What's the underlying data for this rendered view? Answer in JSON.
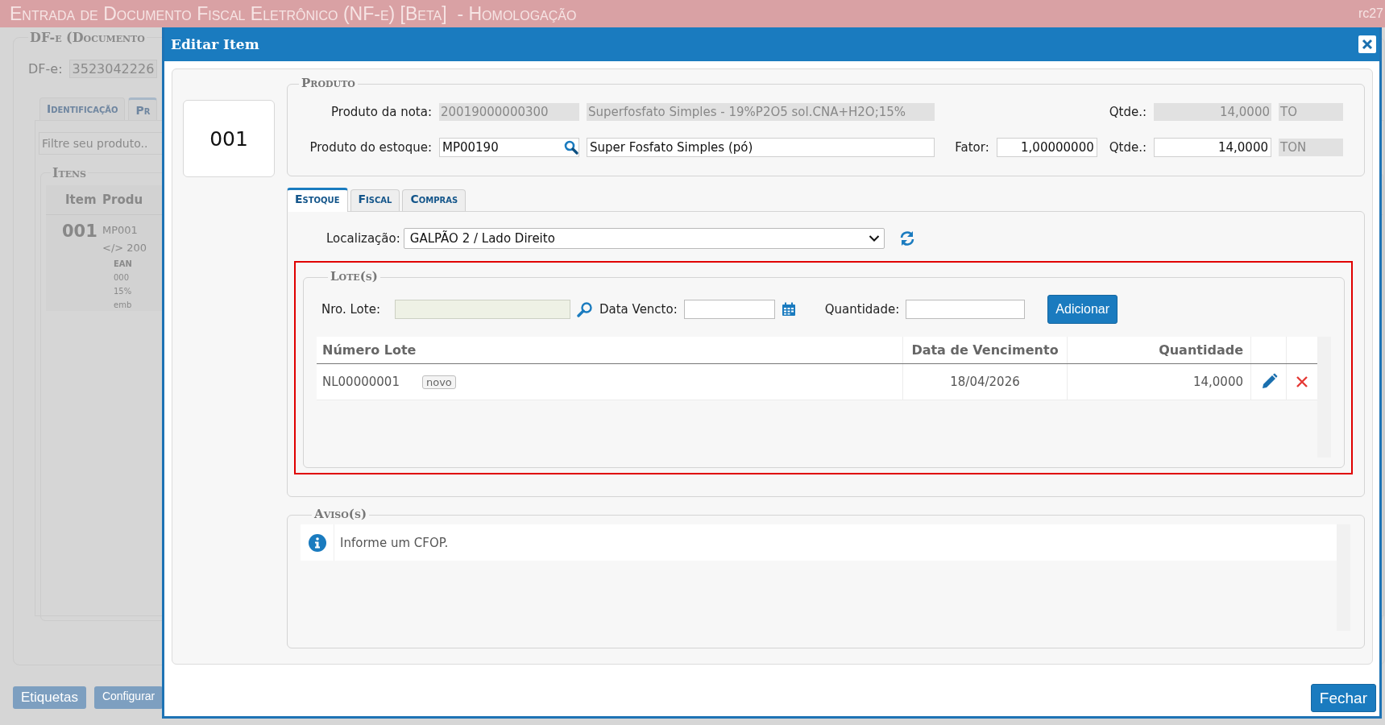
{
  "app": {
    "title": "Entrada de Documento Fiscal Eletrônico (NF-e) [Beta]  - Homologação",
    "version": "rc27"
  },
  "background": {
    "legend": "DF-e (Documento",
    "dfe_label": "DF-e:",
    "dfe_value": "3523042226",
    "tabs": [
      {
        "label": "Identificação",
        "selected": false
      },
      {
        "label": "Pr",
        "selected": true
      }
    ],
    "filter_placeholder": "Filtre seu produto..",
    "items_legend": "Itens",
    "columns": [
      "Item",
      "Produ"
    ],
    "row": {
      "item": "001",
      "lines": [
        "MP001",
        "</> 200"
      ],
      "details": [
        "EAN",
        "000",
        "15%",
        "emb"
      ]
    },
    "buttons": [
      "Etiquetas",
      "Configurar"
    ]
  },
  "dialog": {
    "title": "Editar Item",
    "item_number": "001",
    "produto": {
      "legend": "Produto",
      "nota": {
        "label": "Produto da nota:",
        "code": "20019000000300",
        "description": "Superfosfato Simples - 19%P2O5 sol.CNA+H2O;15%",
        "qty_label": "Qtde.:",
        "qty": "14,0000",
        "unit": "TO"
      },
      "estoque": {
        "label": "Produto do estoque:",
        "code": "MP00190",
        "description": "Super Fosfato Simples (pó)",
        "factor_label": "Fator:",
        "factor": "1,00000000",
        "qty_label": "Qtde.:",
        "qty": "14,0000",
        "unit": "TON"
      }
    },
    "tabs": [
      {
        "label": "Estoque",
        "selected": true
      },
      {
        "label": "Fiscal",
        "selected": false
      },
      {
        "label": "Compras",
        "selected": false
      }
    ],
    "location": {
      "label": "Localização:",
      "value": "GALPÃO 2 / Lado Direito"
    },
    "lotes": {
      "legend": "Lote(s)",
      "highlighted": true,
      "lot_label": "Nro. Lote:",
      "date_label": "Data Vencto:",
      "qty_label": "Quantidade:",
      "add_button": "Adicionar",
      "columns": [
        "Número Lote",
        "Data de Vencimento",
        "Quantidade"
      ],
      "rows": [
        {
          "lot": "NL00000001",
          "tag": "novo",
          "date": "18/04/2026",
          "qty": "14,0000"
        }
      ]
    },
    "avisos": {
      "legend": "Aviso(s)",
      "messages": [
        {
          "kind": "info",
          "text": "Informe um CFOP."
        }
      ]
    },
    "close_button": "Fechar"
  }
}
